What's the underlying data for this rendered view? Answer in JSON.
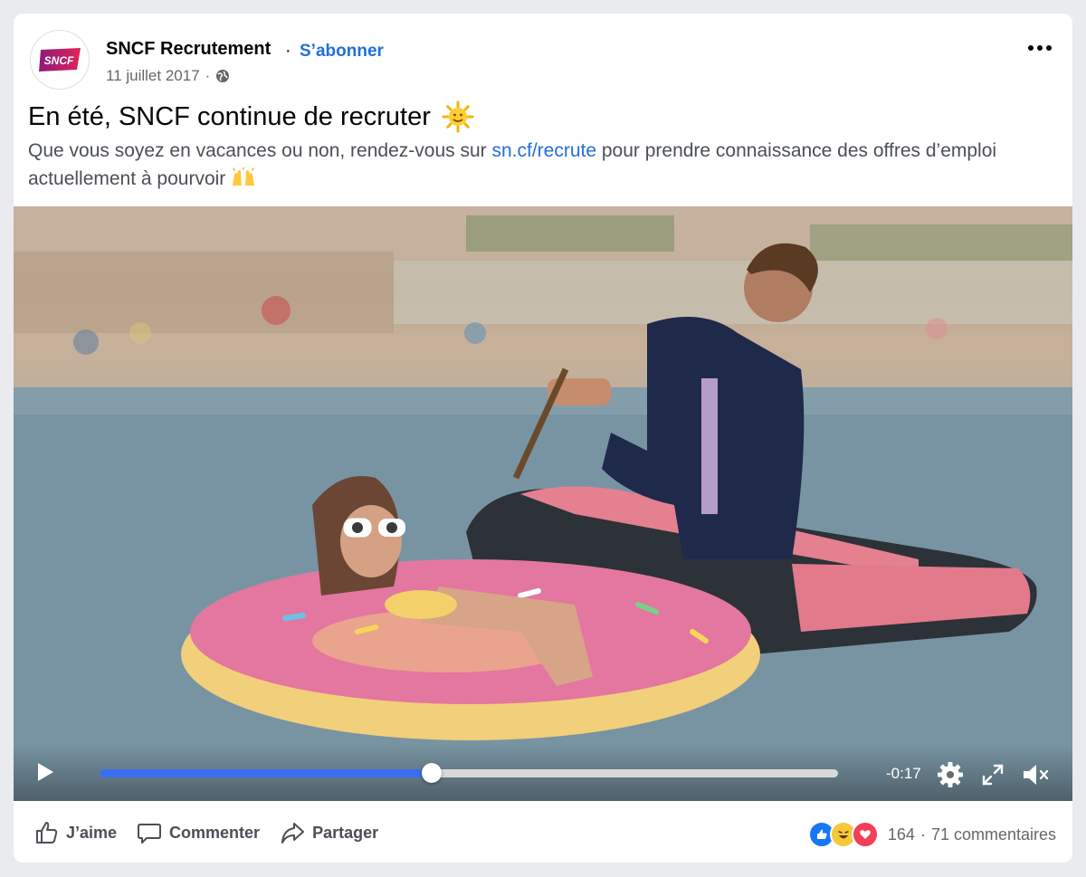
{
  "post": {
    "page_name": "SNCF Recrutement",
    "separator": "·",
    "follow_label": "S’abonner",
    "avatar_logo_text": "SNCF",
    "date": "11 juillet 2017",
    "meta_separator": "·",
    "audience_icon": "globe-icon",
    "more_icon": "more-options-icon",
    "title": "En été, SNCF continue de recruter",
    "title_emoji": "🌞",
    "desc_before": "Que vous soyez en vacances ou non, rendez-vous sur ",
    "desc_link": "sn.cf/recrute",
    "desc_after": " pour prendre connaissance des offres d’emploi actuellement à pourvoir ",
    "desc_emoji": "🙌"
  },
  "video": {
    "scene": "beach-scene-image",
    "progress": 0.45,
    "time_remaining": "-0:17",
    "play_icon": "play-icon",
    "settings_icon": "gear-icon",
    "fullscreen_icon": "fullscreen-icon",
    "mute_icon": "muted-speaker-icon"
  },
  "actions": {
    "like_label": "J’aime",
    "comment_label": "Commenter",
    "share_label": "Partager"
  },
  "stats": {
    "reactions": [
      "like-reaction-icon",
      "haha-reaction-icon",
      "love-reaction-icon"
    ],
    "reaction_count": "164",
    "separator": "·",
    "comments_label": "71 commentaires"
  },
  "colors": {
    "link": "#216fdb",
    "progress": "#3a6ef0",
    "sncf_brand": "#c2185b"
  }
}
